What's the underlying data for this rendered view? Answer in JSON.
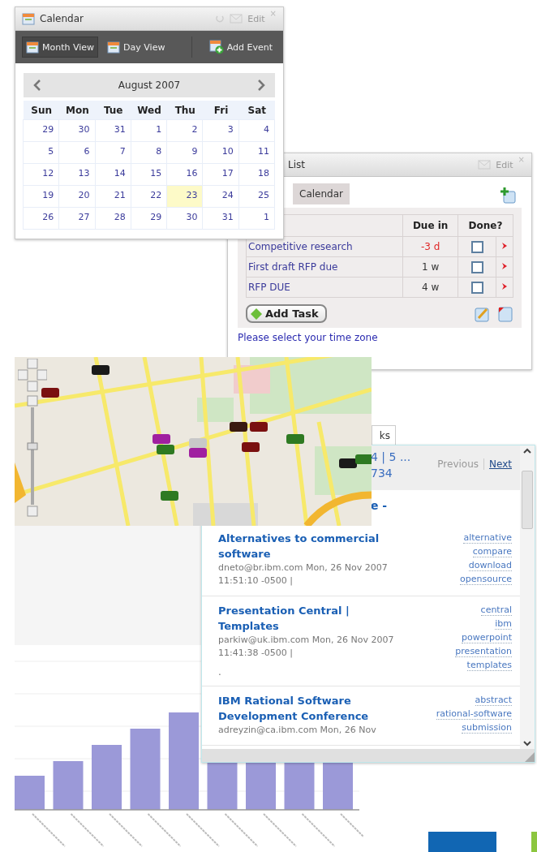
{
  "calendar": {
    "title": "Calendar",
    "edit": "Edit",
    "close": "×",
    "views": [
      {
        "label": "Month View",
        "selected": true
      },
      {
        "label": "Day View",
        "selected": false
      }
    ],
    "add_event": "Add Event",
    "month": "August 2007",
    "weekdays": [
      "Sun",
      "Mon",
      "Tue",
      "Wed",
      "Thu",
      "Fri",
      "Sat"
    ],
    "weeks": [
      [
        {
          "day": "29",
          "selected": false
        },
        {
          "day": "30",
          "selected": false
        },
        {
          "day": "31",
          "selected": false
        },
        {
          "day": "1",
          "selected": false
        },
        {
          "day": "2",
          "selected": false
        },
        {
          "day": "3",
          "selected": false
        },
        {
          "day": "4",
          "selected": false
        }
      ],
      [
        {
          "day": "5",
          "selected": false
        },
        {
          "day": "6",
          "selected": false
        },
        {
          "day": "7",
          "selected": false
        },
        {
          "day": "8",
          "selected": false
        },
        {
          "day": "9",
          "selected": false
        },
        {
          "day": "10",
          "selected": false
        },
        {
          "day": "11",
          "selected": false
        }
      ],
      [
        {
          "day": "12",
          "selected": false
        },
        {
          "day": "13",
          "selected": false
        },
        {
          "day": "14",
          "selected": false
        },
        {
          "day": "15",
          "selected": false
        },
        {
          "day": "16",
          "selected": false
        },
        {
          "day": "17",
          "selected": false
        },
        {
          "day": "18",
          "selected": false
        }
      ],
      [
        {
          "day": "19",
          "selected": false
        },
        {
          "day": "20",
          "selected": false
        },
        {
          "day": "21",
          "selected": false
        },
        {
          "day": "22",
          "selected": false
        },
        {
          "day": "23",
          "selected": true
        },
        {
          "day": "24",
          "selected": false
        },
        {
          "day": "25",
          "selected": false
        }
      ],
      [
        {
          "day": "26",
          "selected": false
        },
        {
          "day": "27",
          "selected": false
        },
        {
          "day": "28",
          "selected": false
        },
        {
          "day": "29",
          "selected": false
        },
        {
          "day": "30",
          "selected": false
        },
        {
          "day": "31",
          "selected": false
        },
        {
          "day": "1",
          "selected": false
        }
      ]
    ]
  },
  "task_list": {
    "title": "List",
    "edit": "Edit",
    "close": "×",
    "tab": "Calendar",
    "columns": [
      "Due in",
      "Done?"
    ],
    "tasks": [
      {
        "name": "Competitive research",
        "due": "-3 d",
        "overdue": true,
        "done": false
      },
      {
        "name": "First draft RFP due",
        "due": "1 w",
        "overdue": false,
        "done": false
      },
      {
        "name": "RFP DUE",
        "due": "4 w",
        "overdue": false,
        "done": false
      }
    ],
    "add_task": "Add Task",
    "time_zone_link": "Please select your time zone"
  },
  "bookmarks": {
    "tab": "ks",
    "pages": "4 | 5 ...",
    "total": "734",
    "previous": "Previous",
    "next": "Next",
    "title_fragment": "e -",
    "entries": [
      {
        "title": "Alternatives to commercial software",
        "meta": "dneto@br.ibm.com Mon, 26 Nov 2007 11:51:10 -0500 |",
        "tags": [
          "alternative",
          "compare",
          "download",
          "opensource"
        ]
      },
      {
        "title": "Presentation Central | Templates",
        "meta": "parkiw@uk.ibm.com Mon, 26 Nov 2007 11:41:38 -0500 |",
        "note": ".",
        "tags": [
          "central",
          "ibm",
          "powerpoint",
          "presentation",
          "templates"
        ]
      },
      {
        "title": "IBM Rational Software Development Conference",
        "meta": "adreyzin@ca.ibm.com Mon, 26 Nov",
        "tags": [
          "abstract",
          "rational-software",
          "submission"
        ]
      }
    ]
  }
}
